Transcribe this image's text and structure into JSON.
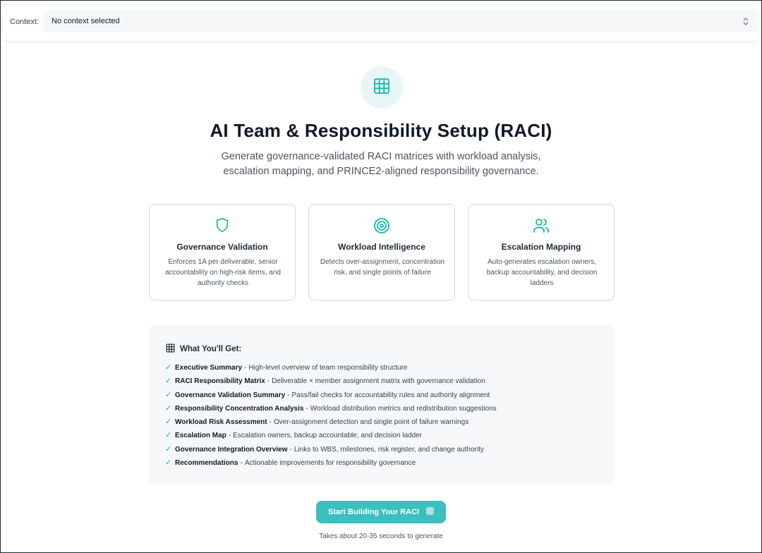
{
  "context": {
    "label": "Context:",
    "selected": "No context selected"
  },
  "hero": {
    "icon": "grid-icon",
    "title": "AI Team & Responsibility Setup (RACI)",
    "subtitle": "Generate governance-validated RACI matrices with workload analysis, escalation mapping, and PRINCE2-aligned responsibility governance."
  },
  "features": [
    {
      "icon": "shield-icon",
      "title": "Governance Validation",
      "description": "Enforces 1A per deliverable, senior accountability on high-risk items, and authority checks"
    },
    {
      "icon": "target-icon",
      "title": "Workload Intelligence",
      "description": "Detects over-assignment, concentration risk, and single points of failure"
    },
    {
      "icon": "users-icon",
      "title": "Escalation Mapping",
      "description": "Auto-generates escalation owners, backup accountability, and decision ladders"
    }
  ],
  "deliverables": {
    "heading": "What You'll Get:",
    "separator": "-",
    "items": [
      {
        "title": "Executive Summary",
        "desc": "High-level overview of team responsibility structure"
      },
      {
        "title": "RACI Responsibility Matrix",
        "desc": "Deliverable × member assignment matrix with governance validation"
      },
      {
        "title": "Governance Validation Summary",
        "desc": "Pass/fail checks for accountability rules and authority alignment"
      },
      {
        "title": "Responsibility Concentration Analysis",
        "desc": "Workload distribution metrics and redistribution suggestions"
      },
      {
        "title": "Workload Risk Assessment",
        "desc": "Over-assignment detection and single point of failure warnings"
      },
      {
        "title": "Escalation Map",
        "desc": "Escalation owners, backup accountable, and decision ladder"
      },
      {
        "title": "Governance Integration Overview",
        "desc": "Links to WBS, milestones, risk register, and change authority"
      },
      {
        "title": "Recommendations",
        "desc": "Actionable improvements for responsibility governance"
      }
    ]
  },
  "cta": {
    "label": "Start Building Your RACI",
    "note": "Takes about 20-35 seconds to generate"
  },
  "colors": {
    "accent": "#14b8a6",
    "button": "#3bbfbf",
    "panel_bg": "#f6f7f8"
  }
}
